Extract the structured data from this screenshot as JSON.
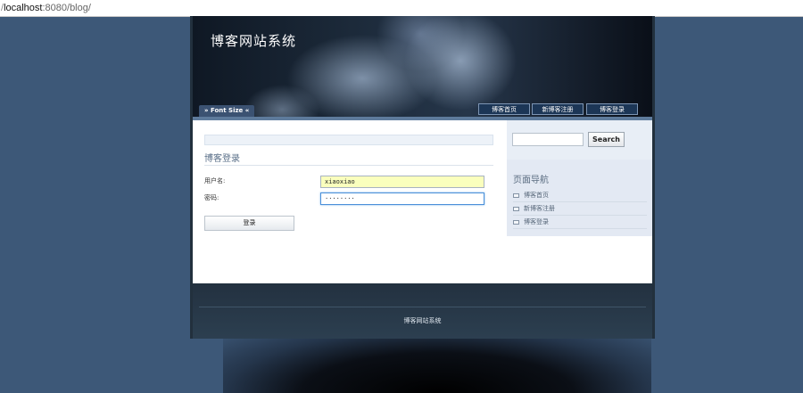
{
  "browser": {
    "url_prefix": "/",
    "url_host": "localhost",
    "url_rest": ":8080/blog/"
  },
  "header": {
    "site_title": "博客网站系统",
    "font_size_label": "» Font Size «",
    "nav": [
      {
        "label": "博客首页"
      },
      {
        "label": "新博客注册"
      },
      {
        "label": "博客登录"
      }
    ]
  },
  "login": {
    "title": "博客登录",
    "username_label": "用户名:",
    "username_value": "xiaoxiao",
    "password_label": "密码:",
    "password_value": "········",
    "submit_label": "登录"
  },
  "sidebar": {
    "search_button": "Search",
    "search_placeholder": "",
    "nav_title": "页面导航",
    "nav_items": [
      {
        "label": "博客首页",
        "icon": "mail-icon"
      },
      {
        "label": "新博客注册",
        "icon": "mail-icon"
      },
      {
        "label": "博客登录",
        "icon": "mail-icon"
      }
    ]
  },
  "footer": {
    "text": "博客网站系统"
  },
  "colors": {
    "background": "#3d5878",
    "nav_button": "#1c3656",
    "autofill": "#faffbd",
    "focus": "#4a90d9"
  }
}
